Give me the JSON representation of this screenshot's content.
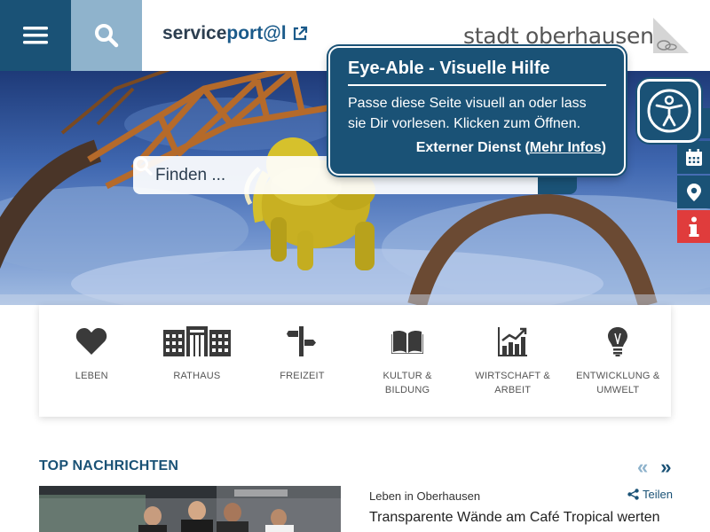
{
  "header": {
    "service_prefix": "service",
    "service_suffix": "port@l",
    "logo_text": "stadt oberhausen"
  },
  "search": {
    "placeholder": "Finden ..."
  },
  "eye_able": {
    "title": "Eye-Able - Visuelle Hilfe",
    "text": "Passe diese Seite visuell an oder lass sie Dir vorlesen. Klicken zum Öffnen.",
    "ext_prefix": "Externer Dienst (",
    "ext_link": "Mehr Infos",
    "ext_suffix": ")"
  },
  "side_tools": [
    {
      "icon": "calendar-icon",
      "color": "#1a5276"
    },
    {
      "icon": "location-icon",
      "color": "#1a5276"
    },
    {
      "icon": "info-icon",
      "color": "#e03c3c"
    }
  ],
  "categories": [
    {
      "line1": "LEBEN",
      "line2": "",
      "icon": "heart-icon"
    },
    {
      "line1": "RATHAUS",
      "line2": "",
      "icon": "town-hall-icon"
    },
    {
      "line1": "FREIZEIT",
      "line2": "",
      "icon": "signpost-icon"
    },
    {
      "line1": "KULTUR &",
      "line2": "BILDUNG",
      "icon": "book-icon"
    },
    {
      "line1": "WIRTSCHAFT &",
      "line2": "ARBEIT",
      "icon": "chart-icon"
    },
    {
      "line1": "ENTWICKLUNG &",
      "line2": "UMWELT",
      "icon": "lightbulb-icon"
    }
  ],
  "news": {
    "section_title": "TOP NACHRICHTEN",
    "prev": "«",
    "next": "»",
    "category": "Leben in Oberhausen",
    "share_label": "Teilen",
    "headline": "Transparente Wände am Café Tropical werten"
  },
  "colors": {
    "primary": "#1a5276",
    "search_bg": "#8fb3cc",
    "alert": "#e03c3c"
  }
}
